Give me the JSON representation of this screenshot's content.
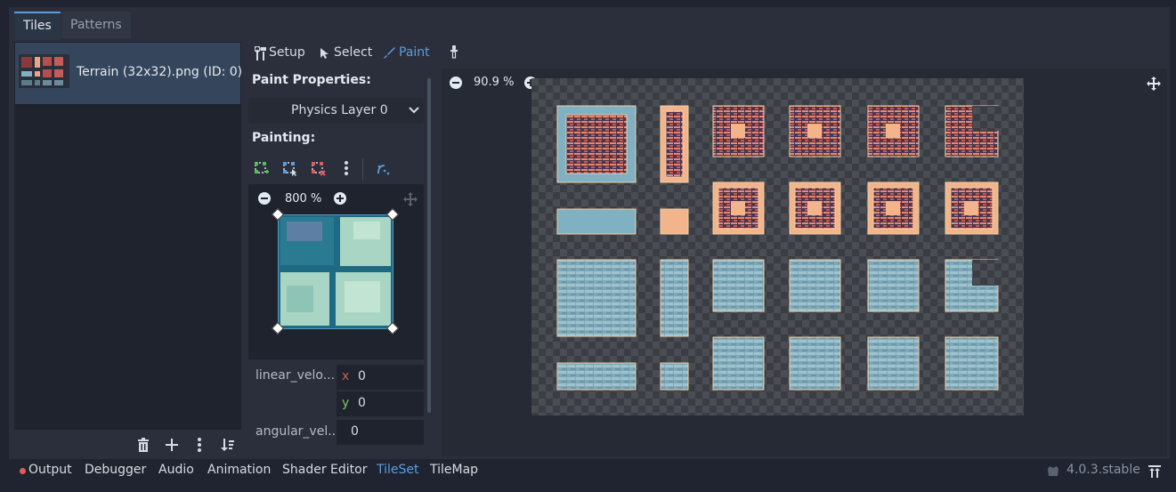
{
  "tabs": [
    {
      "label": "Tiles",
      "active": true
    },
    {
      "label": "Patterns",
      "active": false
    }
  ],
  "source": {
    "name": "Terrain (32x32).png (ID: 0)"
  },
  "toolbar": {
    "setup": "Setup",
    "select": "Select",
    "paint": "Paint"
  },
  "paint": {
    "header": "Paint Properties:",
    "layer_select": "Physics Layer 0",
    "painting_label": "Painting:",
    "preview_zoom": "800 %",
    "fields": {
      "linear_label": "linear_velo...",
      "x_label": "x",
      "x_value": "0",
      "y_label": "y",
      "y_value": "0",
      "angular_label": "angular_vel...",
      "angular_value": "0"
    }
  },
  "atlas": {
    "zoom": "90.9 %"
  },
  "bottom_tabs": [
    "Output",
    "Debugger",
    "Audio",
    "Animation",
    "Shader Editor",
    "TileSet",
    "TileMap"
  ],
  "bottom_active": "TileSet",
  "version": "4.0.3.stable",
  "colors": {
    "accent": "#5a9ee0",
    "error_dot": "#e05c5c",
    "tile_orange": "#f2b48a",
    "tile_blue": "#7fb1c2"
  }
}
